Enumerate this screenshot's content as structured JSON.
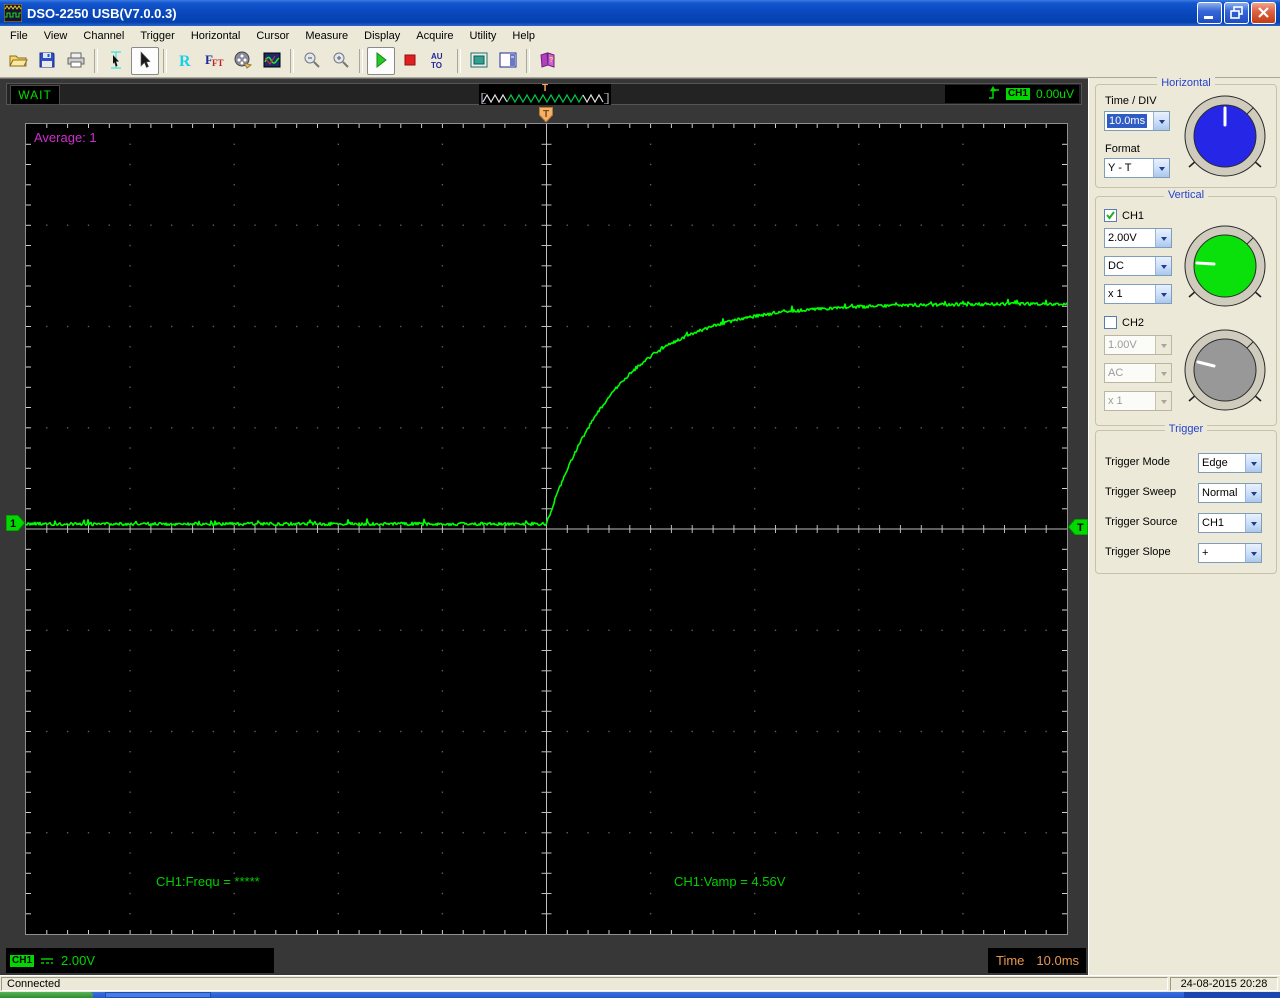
{
  "window": {
    "title": "DSO-2250 USB(V7.0.0.3)"
  },
  "menu": {
    "items": [
      "File",
      "View",
      "Channel",
      "Trigger",
      "Horizontal",
      "Cursor",
      "Measure",
      "Display",
      "Acquire",
      "Utility",
      "Help"
    ]
  },
  "toolbar": {
    "items": [
      "open-folder",
      "save",
      "print",
      "|",
      "cursor-measure",
      "pointer",
      "|",
      "refresh-r",
      "fft",
      "record",
      "waveform-display",
      "|",
      "zoom-out",
      "zoom-in",
      "|",
      "start",
      "stop",
      "auto-setup",
      "|",
      "full-screen",
      "panel-layout",
      "|",
      "help-book"
    ],
    "selected": [
      "pointer",
      "start"
    ]
  },
  "acquisition": {
    "state": "WAIT",
    "top_marker": "T",
    "preview_marker": "T",
    "trigger_source_badge": "CH1",
    "trigger_level": "0.00uV"
  },
  "scope": {
    "average_label": "Average: 1",
    "freq_measure": "CH1:Frequ = *****",
    "vamp_measure": "CH1:Vamp = 4.56V",
    "ch1_marker": "1",
    "trigger_marker": "T"
  },
  "chart_data": {
    "type": "line",
    "title": "CH1 trace",
    "x_axis": {
      "units": "ms",
      "per_div": 10,
      "divisions": 10
    },
    "y_axis": {
      "units": "V",
      "per_div": 2,
      "divisions": 8
    },
    "trigger_position_div": 5,
    "baseline_v": 0.1,
    "plateau_v": 4.45,
    "tau_ms": 7,
    "shape": "flat noisy baseline until trigger at screen center, then exponential (RC-charging) rise to plateau",
    "measured": {
      "frequency": "*****",
      "vamp": "4.56V"
    }
  },
  "panels": {
    "horizontal": {
      "title": "Horizontal",
      "time_div_label": "Time / DIV",
      "time_div_value": "10.0ms",
      "format_label": "Format",
      "format_value": "Y - T"
    },
    "vertical": {
      "title": "Vertical",
      "ch1_label": "CH1",
      "ch1_checked": true,
      "ch1_volts": "2.00V",
      "ch1_coupling": "DC",
      "ch1_probe": "x 1",
      "ch2_label": "CH2",
      "ch2_checked": false,
      "ch2_volts": "1.00V",
      "ch2_coupling": "AC",
      "ch2_probe": "x 1"
    },
    "trigger": {
      "title": "Trigger",
      "rows": [
        [
          "Trigger Mode",
          "Edge"
        ],
        [
          "Trigger Sweep",
          "Normal"
        ],
        [
          "Trigger Source",
          "CH1"
        ],
        [
          "Trigger Slope",
          "+"
        ]
      ]
    }
  },
  "bottom": {
    "ch1_badge": "CH1",
    "ch1_volts": "2.00V",
    "time_label": "Time",
    "time_value": "10.0ms"
  },
  "statusbar": {
    "connection": "Connected",
    "datetime": "24-08-2015  20:28"
  },
  "colors": {
    "trace": "#00ff00",
    "scope_green": "#00cf00",
    "average_magenta": "#cf2fcf",
    "time_orange": "#e89850",
    "badge_green": "#00d800"
  }
}
